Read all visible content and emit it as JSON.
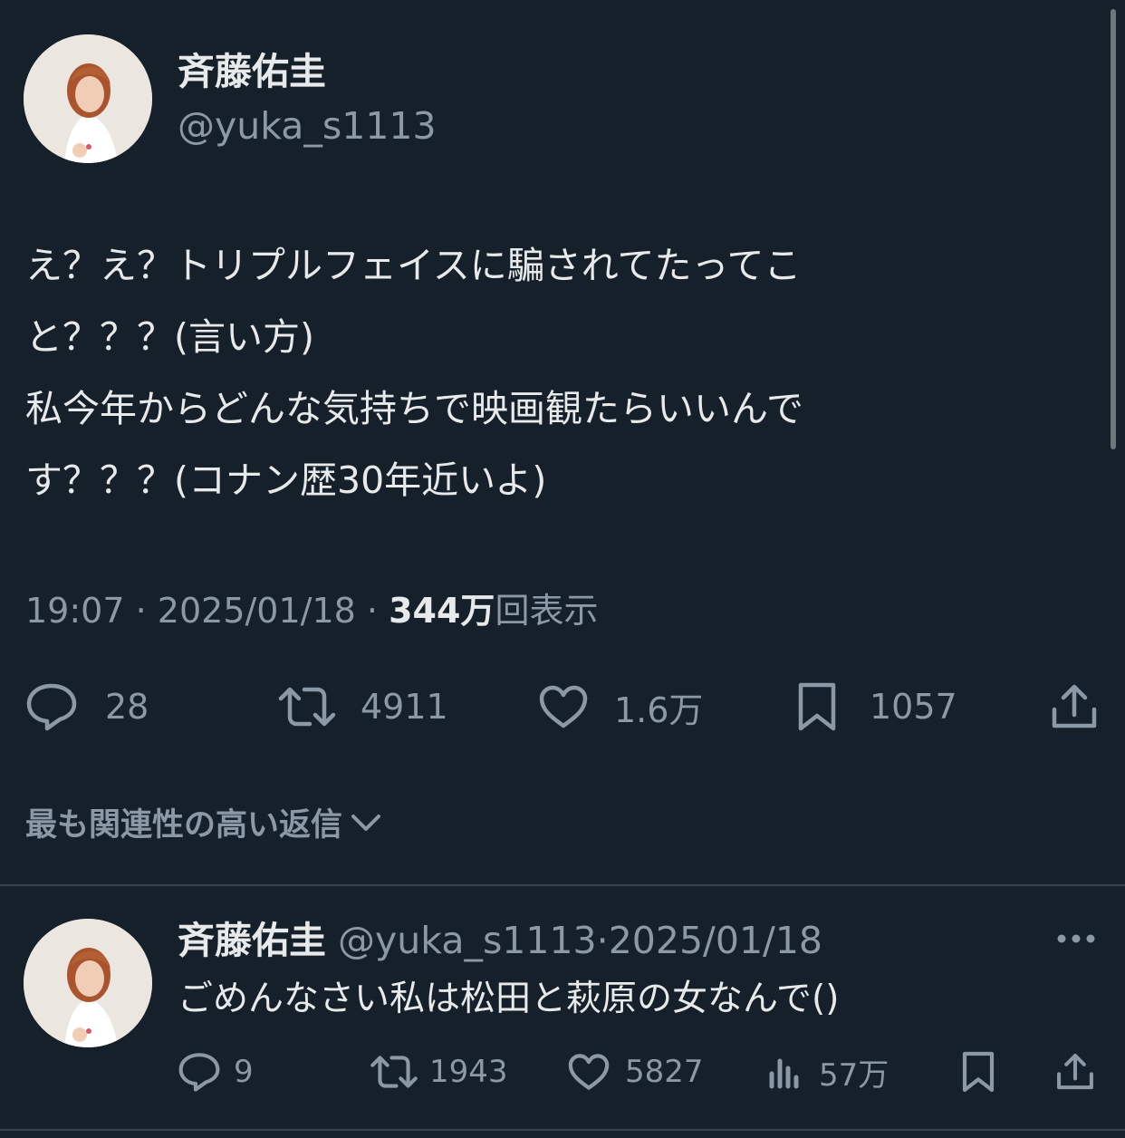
{
  "main_tweet": {
    "display_name": "斉藤佑圭",
    "handle": "@yuka_s1113",
    "text_lines": [
      "え？え？トリプルフェイスに騙されてたってこ",
      "と？？？(言い方)",
      "私今年からどんな気持ちで映画観たらいいんで",
      "す？？？(コナン歴30年近いよ)"
    ],
    "time": "19:07",
    "separator": "·",
    "date": "2025/01/18",
    "views_count": "344万",
    "views_label": "回表示",
    "actions": {
      "replies": "28",
      "retweets": "4911",
      "likes": "1.6万",
      "bookmarks": "1057"
    },
    "icons": [
      "reply-icon",
      "retweet-icon",
      "like-icon",
      "bookmark-icon",
      "share-icon"
    ]
  },
  "sort": {
    "label": "最も関連性の高い返信",
    "icon": "chevron-down-icon"
  },
  "reply_tweet": {
    "display_name": "斉藤佑圭",
    "handle": "@yuka_s1113",
    "separator": "·",
    "date": "2025/01/18",
    "text": "ごめんなさい私は松田と萩原の女なんで()",
    "actions": {
      "replies": "9",
      "retweets": "1943",
      "likes": "5827",
      "views": "57万"
    },
    "icons": [
      "more-icon",
      "reply-icon",
      "retweet-icon",
      "like-icon",
      "views-icon",
      "bookmark-icon",
      "share-icon"
    ]
  },
  "colors": {
    "background": "#15202b",
    "text": "#e7e9ea",
    "secondary": "#8b98a5",
    "divider": "#38444d"
  }
}
